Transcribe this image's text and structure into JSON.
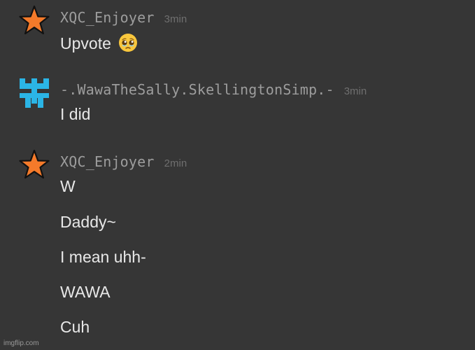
{
  "messages": [
    {
      "username": "XQC_Enjoyer",
      "timestamp": "3min",
      "avatar": "orange-star-icon",
      "lines": [
        "Upvote"
      ],
      "emoji": "pleading-face-emoji"
    },
    {
      "username": "-.WawaTheSally.SkellingtonSimp.-",
      "timestamp": "3min",
      "avatar": "cyan-glyph-icon",
      "lines": [
        "I did"
      ]
    },
    {
      "username": "XQC_Enjoyer",
      "timestamp": "2min",
      "avatar": "orange-star-icon",
      "lines": [
        "W",
        "Daddy~",
        "I mean uhh-",
        "WAWA",
        "Cuh"
      ]
    }
  ],
  "watermark": "imgflip.com",
  "colors": {
    "background": "#363636",
    "star": "#f47a2a",
    "glyph": "#2bb5e6",
    "username": "#9d9d9d",
    "timestamp": "#6f6f6f",
    "message_text": "#e8e8e8"
  }
}
